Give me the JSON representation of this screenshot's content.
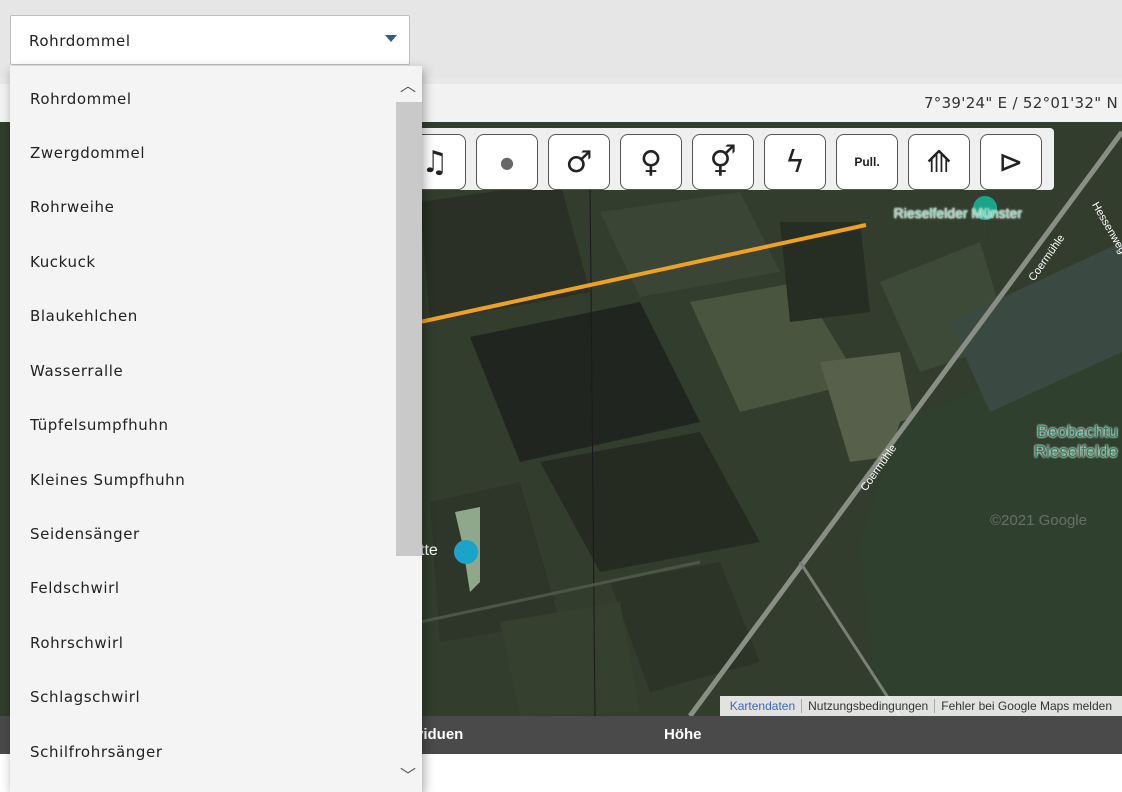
{
  "select": {
    "value": "Rohrdommel",
    "options": [
      "Rohrdommel",
      "Zwergdommel",
      "Rohrweihe",
      "Kuckuck",
      "Blaukehlchen",
      "Wasserralle",
      "Tüpfelsumpfhuhn",
      "Kleines Sumpfhuhn",
      "Seidensänger",
      "Feldschwirl",
      "Rohrschwirl",
      "Schlagschwirl",
      "Schilfrohrsänger"
    ]
  },
  "map": {
    "coordinates": "7°39'24\" E / 52°01'32\" N",
    "labels": {
      "rieselfelder": "Rieselfelder Münster",
      "coermuehle_top": "Coermühle",
      "coermuehle_mid": "Coermühle",
      "hessenweg": "Hessenweg",
      "beobachtung_1": "Beobachtu",
      "beobachtung_2": "Rieselfelde",
      "hide_partial": "tte",
      "copyright": "©2021 Google"
    },
    "attribution": [
      "Kartendaten",
      "Nutzungsbedingungen",
      "Fehler bei Google Maps melden"
    ]
  },
  "toolbar": {
    "buttons": [
      {
        "name": "music-note-icon",
        "glyph": "♫"
      },
      {
        "name": "circle-icon",
        "glyph": "●"
      },
      {
        "name": "male-icon",
        "glyph": "♂"
      },
      {
        "name": "female-icon",
        "glyph": "♀"
      },
      {
        "name": "hermaphrodite-icon",
        "glyph": "⚥"
      },
      {
        "name": "lightning-icon",
        "glyph": "ϟ"
      },
      {
        "name": "pull-button",
        "glyph": "Pull."
      },
      {
        "name": "bird-flyover-icon",
        "glyph": "⟰"
      },
      {
        "name": "bird-icon",
        "glyph": "⊳"
      }
    ]
  },
  "table": {
    "headers": [
      "viduen",
      "Höhe"
    ]
  },
  "colors": {
    "track": "#f0a21c",
    "header": "#4a4a4a",
    "caret": "#3b5a7e",
    "marker": "#1aa58a"
  }
}
